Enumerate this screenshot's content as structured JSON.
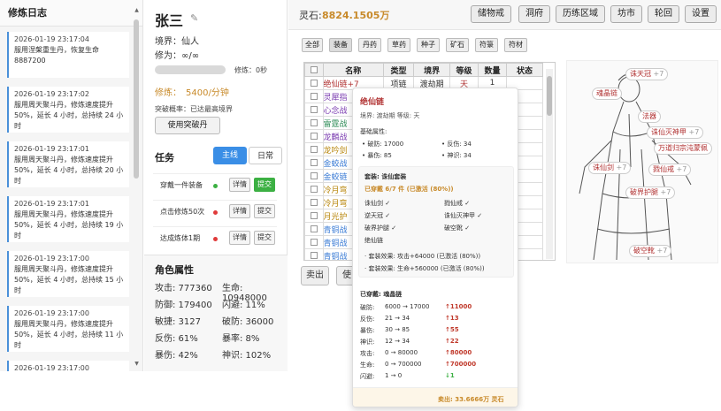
{
  "log": {
    "title": "修炼日志",
    "entries": [
      {
        "time": "2026-01-19 23:17:04",
        "text": "服用涅槃重生丹，恢复生命 8887200"
      },
      {
        "time": "2026-01-19 23:17:02",
        "text": "服用周天聚斗丹，修炼速度提升50%，延长 4 小时，总持续 24 小时"
      },
      {
        "time": "2026-01-19 23:17:01",
        "text": "服用周天聚斗丹，修炼速度提升50%，延长 4 小时，总持续 20 小时"
      },
      {
        "time": "2026-01-19 23:17:01",
        "text": "服用周天聚斗丹，修炼速度提升50%，延长 4 小时，总持续 19 小时"
      },
      {
        "time": "2026-01-19 23:17:00",
        "text": "服用周天聚斗丹，修炼速度提升50%，延长 4 小时，总持续 15 小时"
      },
      {
        "time": "2026-01-19 23:17:00",
        "text": "服用周天聚斗丹，修炼速度提升50%，延长 4 小时，总持续 11 小时"
      },
      {
        "time": "2026-01-19 23:17:00",
        "text": ""
      }
    ]
  },
  "character": {
    "name": "张三",
    "realm": "境界：仙人",
    "cultivation": "修为：∞/∞",
    "progress_label": "修炼：0秒",
    "progress_fraction": 0,
    "speed_label": "修炼：",
    "speed_value": "5400/分钟",
    "breakthrough": "突破概率：已达最高境界",
    "breakthrough_button": "使用突破丹"
  },
  "tasks": {
    "title": "任务",
    "tab_main": "主线",
    "tab_daily": "日常",
    "items": [
      {
        "name": "穿戴一件装备",
        "dot_color": "#3cb043",
        "detail": "详情",
        "submit": "提交",
        "submit_active": true
      },
      {
        "name": "点击修炼50次",
        "dot_color": "#e03a3a",
        "detail": "详情",
        "submit": "提交",
        "submit_active": false
      },
      {
        "name": "达成炼体1期",
        "dot_color": "#e03a3a",
        "detail": "详情",
        "submit": "提交",
        "submit_active": false
      }
    ]
  },
  "attributes": {
    "title": "角色属性",
    "left": [
      {
        "k": "攻击: 777360"
      },
      {
        "k": "防御: 179400"
      },
      {
        "k": "敏捷: 3127"
      },
      {
        "k": "反伤: 61%"
      },
      {
        "k": "暴伤: 42%"
      }
    ],
    "right": [
      {
        "k": "生命: 10948000"
      },
      {
        "k": "闪避: 11%"
      },
      {
        "k": "破防: 36000"
      },
      {
        "k": "暴率: 8%"
      },
      {
        "k": "神识: 102%"
      }
    ]
  },
  "top": {
    "spirit_label": "灵石:",
    "spirit_value": "8824.1505万",
    "nav": [
      "储物戒",
      "洞府",
      "历练区域",
      "坊市",
      "轮回",
      "设置"
    ]
  },
  "filters": [
    "全部",
    "装备",
    "丹药",
    "草药",
    "种子",
    "矿石",
    "符箓",
    "符材"
  ],
  "inventory": {
    "headers": [
      "名称",
      "类型",
      "境界",
      "等级",
      "数量",
      "状态"
    ],
    "rows": [
      {
        "name": "绝仙链+7",
        "color": "#b03030",
        "type": "项链",
        "realm": "渡劫期",
        "level": "天",
        "qty": "1",
        "status": ""
      },
      {
        "name": "灵犀指",
        "color": "#7a3bb0",
        "type": "",
        "realm": "",
        "level": "",
        "qty": "",
        "status": ""
      },
      {
        "name": "心念战",
        "color": "#7a3bb0",
        "type": "",
        "realm": "",
        "level": "",
        "qty": "",
        "status": ""
      },
      {
        "name": "雷霆战",
        "color": "#2e8b57",
        "type": "",
        "realm": "",
        "level": "",
        "qty": "",
        "status": ""
      },
      {
        "name": "龙麟战",
        "color": "#7a3bb0",
        "type": "",
        "realm": "",
        "level": "",
        "qty": "",
        "status": ""
      },
      {
        "name": "龙吟剑",
        "color": "#b8860b",
        "type": "",
        "realm": "",
        "level": "",
        "qty": "",
        "status": ""
      },
      {
        "name": "金蛟战",
        "color": "#3a7bd5",
        "type": "",
        "realm": "",
        "level": "",
        "qty": "",
        "status": ""
      },
      {
        "name": "金蛟链",
        "color": "#3a7bd5",
        "type": "",
        "realm": "",
        "level": "",
        "qty": "",
        "status": ""
      },
      {
        "name": "冷月弯",
        "color": "#b8860b",
        "type": "",
        "realm": "",
        "level": "",
        "qty": "",
        "status": ""
      },
      {
        "name": "冷月弯",
        "color": "#b8860b",
        "type": "",
        "realm": "",
        "level": "",
        "qty": "",
        "status": ""
      },
      {
        "name": "月光护",
        "color": "#b8860b",
        "type": "",
        "realm": "",
        "level": "",
        "qty": "",
        "status": ""
      },
      {
        "name": "青铜战",
        "color": "#3a7bd5",
        "type": "",
        "realm": "",
        "level": "",
        "qty": "",
        "status": ""
      },
      {
        "name": "青铜战",
        "color": "#3a7bd5",
        "type": "",
        "realm": "",
        "level": "",
        "qty": "",
        "status": ""
      },
      {
        "name": "青铜战",
        "color": "#3a7bd5",
        "type": "",
        "realm": "",
        "level": "",
        "qty": "",
        "status": ""
      }
    ]
  },
  "actions": {
    "sell": "卖出",
    "use": "使"
  },
  "equipment_tags": [
    {
      "name": "诛天冠",
      "plus": "+7"
    },
    {
      "name": "魂晶链",
      "plus": ""
    },
    {
      "name": "法器",
      "plus": ""
    },
    {
      "name": "诛仙灭神甲",
      "plus": "+7"
    },
    {
      "name": "万道归宗沌蒙佩",
      "plus": ""
    },
    {
      "name": "诛仙剑",
      "plus": "+7"
    },
    {
      "name": "戮仙戒",
      "plus": "+7"
    },
    {
      "name": "破界护腿",
      "plus": "+7"
    },
    {
      "name": "破空靴",
      "plus": "+7"
    }
  ],
  "tooltip": {
    "name": "绝仙链",
    "sub": "境界: 渡劫期    等级: 天",
    "base_title": "基础属性:",
    "base": [
      "• 破防: 17000",
      "• 反伤: 34",
      "• 暴伤: 85",
      "• 神识: 34"
    ],
    "set_title": "套装: 诛仙套装",
    "set_count": "已穿戴 6/7 件 (已激活 (80%))",
    "set_parts": [
      "诛仙剑 ✓",
      "戮仙戒 ✓",
      "逆天冠 ✓",
      "诛仙灭神甲 ✓",
      "破界护腿 ✓",
      "破空靴 ✓",
      "绝仙链"
    ],
    "set_effect1": "· 套装效果: 攻击+64000 (已激活 (80%))",
    "set_effect2": "· 套装效果: 生命+560000 (已激活 (80%))",
    "worn_title": "已穿戴: 魂晶链",
    "compare": [
      {
        "k": "破防:",
        "v": "6000 → 17000",
        "d": "↑11000",
        "up": true
      },
      {
        "k": "反伤:",
        "v": "21 → 34",
        "d": "↑13",
        "up": true
      },
      {
        "k": "暴伤:",
        "v": "30 → 85",
        "d": "↑55",
        "up": true
      },
      {
        "k": "神识:",
        "v": "12 → 34",
        "d": "↑22",
        "up": true
      },
      {
        "k": "攻击:",
        "v": "0 → 80000",
        "d": "↑80000",
        "up": true
      },
      {
        "k": "生命:",
        "v": "0 → 700000",
        "d": "↑700000",
        "up": true
      },
      {
        "k": "闪避:",
        "v": "1 → 0",
        "d": "↓1",
        "up": false
      }
    ],
    "sell_price": "卖出: 33.6666万 灵石"
  }
}
